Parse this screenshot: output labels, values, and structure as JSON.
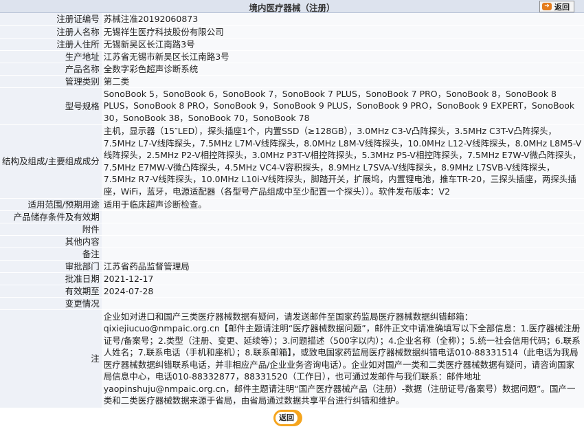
{
  "header": {
    "title": "境内医疗器械（注册）",
    "back_label": "返回"
  },
  "rows": {
    "reg_no": {
      "label": "注册证编号",
      "value": "苏械注准20192060873"
    },
    "registrant": {
      "label": "注册人名称",
      "value": "无锡祥生医疗科技股份有限公司"
    },
    "residence": {
      "label": "注册人住所",
      "value": "无锡新吴区长江南路3号"
    },
    "address": {
      "label": "生产地址",
      "value": "江苏省无锡市新吴区长江南路3号"
    },
    "product": {
      "label": "产品名称",
      "value": "全数字彩色超声诊断系统"
    },
    "category": {
      "label": "管理类别",
      "value": "第二类"
    },
    "model": {
      "label": "型号规格",
      "value": "SonoBook 5，SonoBook 6，SonoBook 7，SonoBook 7 PLUS，SonoBook 7 PRO，SonoBook 8，SonoBook 8 PLUS，SonoBook 8 PRO，SonoBook 9，SonoBook 9 PLUS，SonoBook 9 PRO，SonoBook 9 EXPERT，SonoBook 30，SonoBook 38，SonoBook 70，SonoBook 78"
    },
    "structure": {
      "label": "结构及组成/主要组成成分",
      "value": "主机，显示器（15″LED），探头插座1个，内置SSD（≥128GB），3.0MHz C3-V凸阵探头，3.5MHz C3T-V凸阵探头，7.5MHz L7-V线阵探头，7.5MHz L7M-V线阵探头，8.0MHz L8M-V线阵探头，10.0MHz L12-V线阵探头，8.0MHz L8M5-V线阵探头，2.5MHz P2-V相控阵探头，3.0MHz P3T-V相控阵探头，5.3MHz P5-V相控阵探头，7.5MHz E7W-V微凸阵探头，7.5MHz E7MW-V微凸阵探头，4.5MHz VC4-V容积探头，8.9MHz L7SVA-V线阵探头，8.9MHz L7SVB-V线阵探头，7.5MHz R7-V线阵探头，10.0MHz L10i-V线阵探头，脚踏开关，扩展坞，内置锂电池，推车TR-20，三探头插座，两探头插座，WiFi，蓝牙，电源适配器（各型号产品组成中至少配置一个探头））。软件发布版本：V2"
    },
    "scope": {
      "label": "适用范围/预期用途",
      "value": "适用于临床超声诊断检查。"
    },
    "storage": {
      "label": "产品储存条件及有效期",
      "value": ""
    },
    "attachment": {
      "label": "附件",
      "value": ""
    },
    "other": {
      "label": "其他内容",
      "value": ""
    },
    "remark": {
      "label": "备注",
      "value": ""
    },
    "dept": {
      "label": "审批部门",
      "value": "江苏省药品监督管理局"
    },
    "approval_date": {
      "label": "批准日期",
      "value": "2021-12-17"
    },
    "valid_until": {
      "label": "有效期至",
      "value": "2024-07-28"
    },
    "changes": {
      "label": "变更情况",
      "value": ""
    },
    "note": {
      "label": "注",
      "value": "企业如对进口和国产三类医疗器械数据有疑问，请发送邮件至国家药监局医疗器械数据纠错邮箱：qixiejiucuo@nmpaic.org.cn【邮件主题请注明“医疗器械数据问题”，邮件正文中请准确填写以下全部信息：1.医疗器械注册证号/备案号；2.类型（注册、变更、延续等）；3.问题描述（500字以内）；4.企业名称（全称）；5.统一社会信用代码；6.联系人姓名；7.联系电话（手机和座机）；8.联系邮箱】，或致电国家药监局医疗器械数据纠错电话010-88331514（此电话为我局医疗器械数据纠错联系电话，并非相应产品/企业业务咨询电话）。企业如对国产一类和二类医疗器械数据有疑问，请咨询国家局信息中心，电话010-88332877，88331520（工作日），也可通过发邮件与我们联系：邮件地址yaopinshuju@nmpaic.org.cn，邮件主题请注明“国产医疗器械产品（注册）-数据（注册证号/备案号）数据问题”。国产一类和二类医疗器械数据来源于省局，由省局通过数据共享平台进行纠错和维护。"
    }
  },
  "footer": {
    "back_label": "返回"
  }
}
